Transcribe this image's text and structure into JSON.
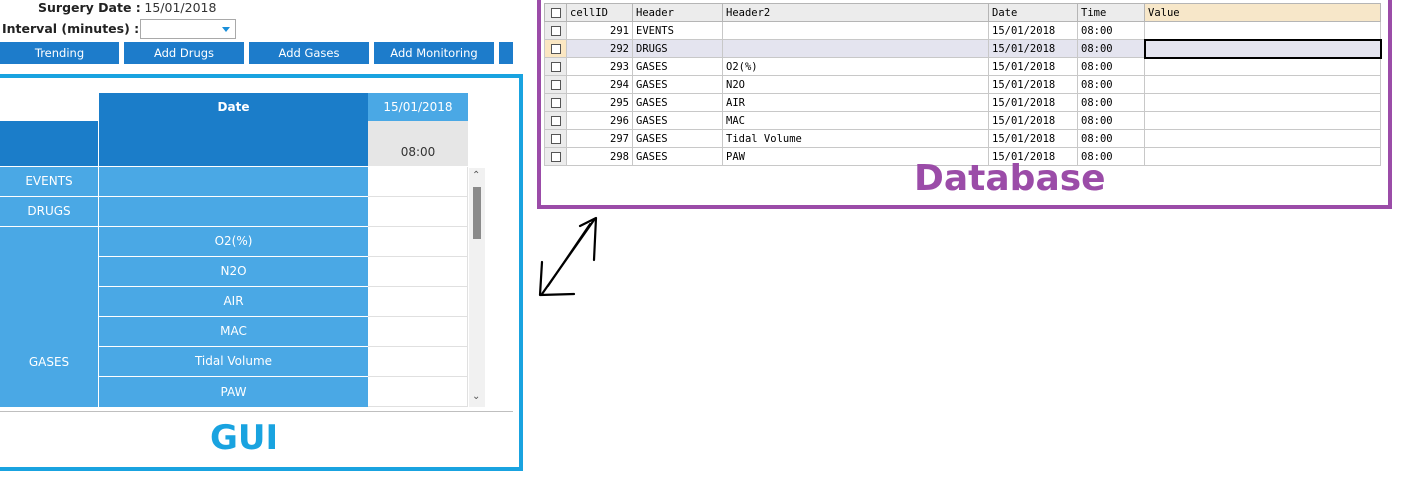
{
  "form": {
    "surgery_date_label": "Surgery Date :",
    "surgery_date_value": "15/01/2018",
    "interval_label": "Interval (minutes) :",
    "interval_value": ""
  },
  "toolbar": {
    "trending": "Trending",
    "add_drugs": "Add Drugs",
    "add_gases": "Add Gases",
    "add_monitoring": "Add Monitoring"
  },
  "gui": {
    "caption": "GUI",
    "date_header": "Date",
    "date_value": "15/01/2018",
    "time_value": "08:00",
    "rows": {
      "events": "EVENTS",
      "drugs": "DRUGS",
      "gases": "GASES",
      "o2": "O2(%)",
      "n2o": "N2O",
      "air": "AIR",
      "mac": "MAC",
      "tidal": "Tidal Volume",
      "paw": "PAW"
    },
    "scroll_up": "⌃",
    "scroll_down": "⌄"
  },
  "database": {
    "caption": "Database",
    "columns": [
      "cellID",
      "Header",
      "Header2",
      "Date",
      "Time",
      "Value"
    ],
    "rows": [
      {
        "cellID": "291",
        "Header": "EVENTS",
        "Header2": "",
        "Date": "15/01/2018",
        "Time": "08:00",
        "Value": ""
      },
      {
        "cellID": "292",
        "Header": "DRUGS",
        "Header2": "",
        "Date": "15/01/2018",
        "Time": "08:00",
        "Value": ""
      },
      {
        "cellID": "293",
        "Header": "GASES",
        "Header2": "O2(%)",
        "Date": "15/01/2018",
        "Time": "08:00",
        "Value": ""
      },
      {
        "cellID": "294",
        "Header": "GASES",
        "Header2": "N2O",
        "Date": "15/01/2018",
        "Time": "08:00",
        "Value": ""
      },
      {
        "cellID": "295",
        "Header": "GASES",
        "Header2": "AIR",
        "Date": "15/01/2018",
        "Time": "08:00",
        "Value": ""
      },
      {
        "cellID": "296",
        "Header": "GASES",
        "Header2": "MAC",
        "Date": "15/01/2018",
        "Time": "08:00",
        "Value": ""
      },
      {
        "cellID": "297",
        "Header": "GASES",
        "Header2": "Tidal Volume",
        "Date": "15/01/2018",
        "Time": "08:00",
        "Value": ""
      },
      {
        "cellID": "298",
        "Header": "GASES",
        "Header2": "PAW",
        "Date": "15/01/2018",
        "Time": "08:00",
        "Value": ""
      }
    ]
  },
  "colors": {
    "gui_accent": "#19a3e0",
    "db_accent": "#9b4ca8",
    "header_dark": "#1b7dc9",
    "header_light": "#4aa8e5"
  },
  "icons": {
    "dropdown": "caret-down-icon",
    "sync_arrow": "double-arrow-icon"
  }
}
